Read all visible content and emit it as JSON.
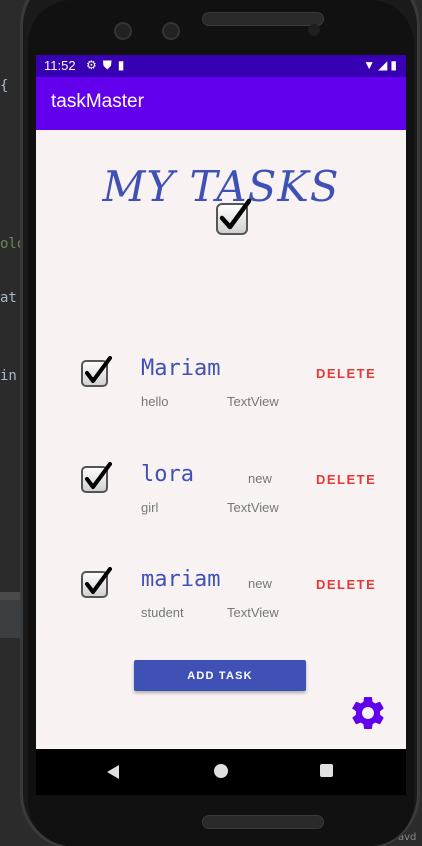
{
  "ide": {
    "lines": [
      "{",
      "olo",
      "at",
      "in"
    ],
    "corner": "avd"
  },
  "status_bar": {
    "time": "11:52"
  },
  "app": {
    "title": "taskMaster"
  },
  "main": {
    "heading": "MY TASKS",
    "tasks": [
      {
        "title": "Mariam",
        "badge": "",
        "body": "hello",
        "textview": "TextView",
        "delete_label": "DELETE"
      },
      {
        "title": "lora",
        "badge": "new",
        "body": "girl",
        "textview": "TextView",
        "delete_label": "DELETE"
      },
      {
        "title": "mariam",
        "badge": "new",
        "body": "student",
        "textview": "TextView",
        "delete_label": "DELETE"
      }
    ],
    "add_task_label": "ADD TASK"
  },
  "colors": {
    "status_bar": "#3700b3",
    "app_bar": "#6200ee",
    "accent": "#3f51b5",
    "delete": "#e53935",
    "gear": "#6200ee",
    "background": "#f8f3f2"
  },
  "icons": {
    "checkbox": "checkbox-icon",
    "settings": "gear-icon",
    "back": "back-icon",
    "home": "home-icon",
    "recents": "recents-icon"
  }
}
